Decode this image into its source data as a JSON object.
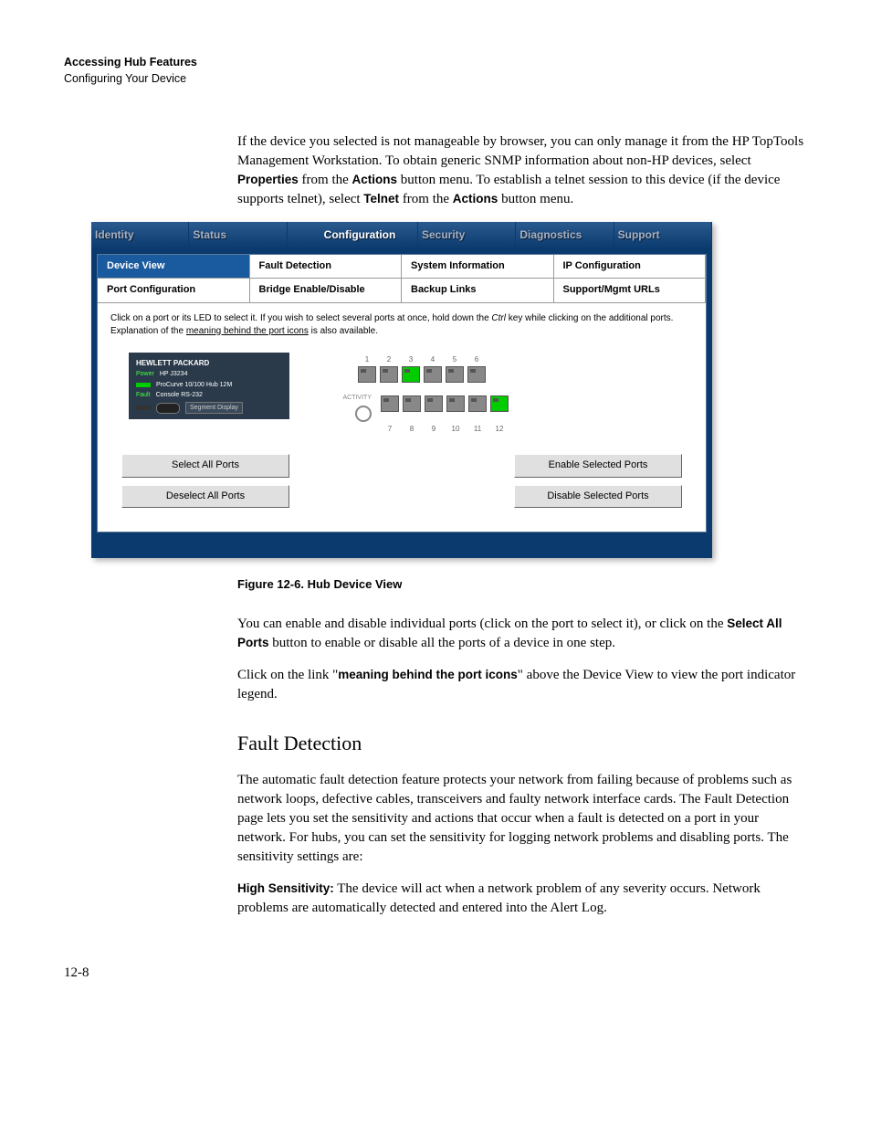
{
  "header": {
    "title": "Accessing Hub Features",
    "subtitle": "Configuring Your Device"
  },
  "intro": {
    "p1a": "If the device you selected is not manageable by browser, you can only manage it from the HP TopTools Management Workstation. To obtain generic SNMP information about non-HP devices, select ",
    "p1b": "Properties",
    "p1c": " from the ",
    "p1d": "Actions",
    "p1e": " button menu. To establish a telnet session to this device (if the device supports telnet), select ",
    "p1f": "Telnet",
    "p1g": " from the ",
    "p1h": "Actions",
    "p1i": " button menu."
  },
  "ui": {
    "mainTabs": [
      "Identity",
      "Status",
      "Configuration",
      "Security",
      "Diagnostics",
      "Support"
    ],
    "subTabs": [
      "Device View",
      "Fault Detection",
      "System Information",
      "IP Configuration",
      "Port Configuration",
      "Bridge Enable/Disable",
      "Backup Links",
      "Support/Mgmt URLs"
    ],
    "instructionA": "Click on a port or its LED to select it. If you wish to select several ports at once, hold down the ",
    "instructionB": "Ctrl",
    "instructionC": " key while clicking on the additional ports. Explanation of the ",
    "instructionD": "meaning behind the port icons",
    "instructionE": " is also available.",
    "device": {
      "brand": "HEWLETT PACKARD",
      "model": "HP J3234",
      "product": "ProCurve 10/100 Hub 12M",
      "console": "Console RS-232",
      "power": "Power",
      "fault": "Fault",
      "segment": "Segment Display",
      "activity": "ACTIVITY"
    },
    "portsTop": [
      "1",
      "2",
      "3",
      "4",
      "5",
      "6"
    ],
    "portsBottom": [
      "7",
      "8",
      "9",
      "10",
      "11",
      "12"
    ],
    "buttons": {
      "selectAll": "Select All Ports",
      "deselectAll": "Deselect All Ports",
      "enableSel": "Enable Selected Ports",
      "disableSel": "Disable Selected Ports"
    }
  },
  "figureCaption": "Figure 12-6.  Hub Device View",
  "afterFigure": {
    "p1a": "You can enable and disable individual ports (click on the port to select it), or click on the ",
    "p1b": "Select All Ports",
    "p1c": " button to enable or disable all the ports of a device in one step.",
    "p2a": "Click on the link \"",
    "p2b": "meaning behind the port icons",
    "p2c": "\" above the Device View to view the port indicator legend."
  },
  "faultDetection": {
    "heading": "Fault Detection",
    "p1": "The automatic fault detection feature protects your network from failing because of problems such as network loops, defective cables, transceivers and faulty network interface cards. The Fault Detection page lets you set the sensitivity and actions that occur when a fault is detected on a port in your network. For hubs, you can set the sensitivity for logging network problems and disabling ports. The sensitivity settings are:",
    "p2a": "High Sensitivity:",
    "p2b": " The device will act when a network problem of any severity occurs. Network problems are automatically detected and entered into the Alert Log."
  },
  "pageNumber": "12-8"
}
